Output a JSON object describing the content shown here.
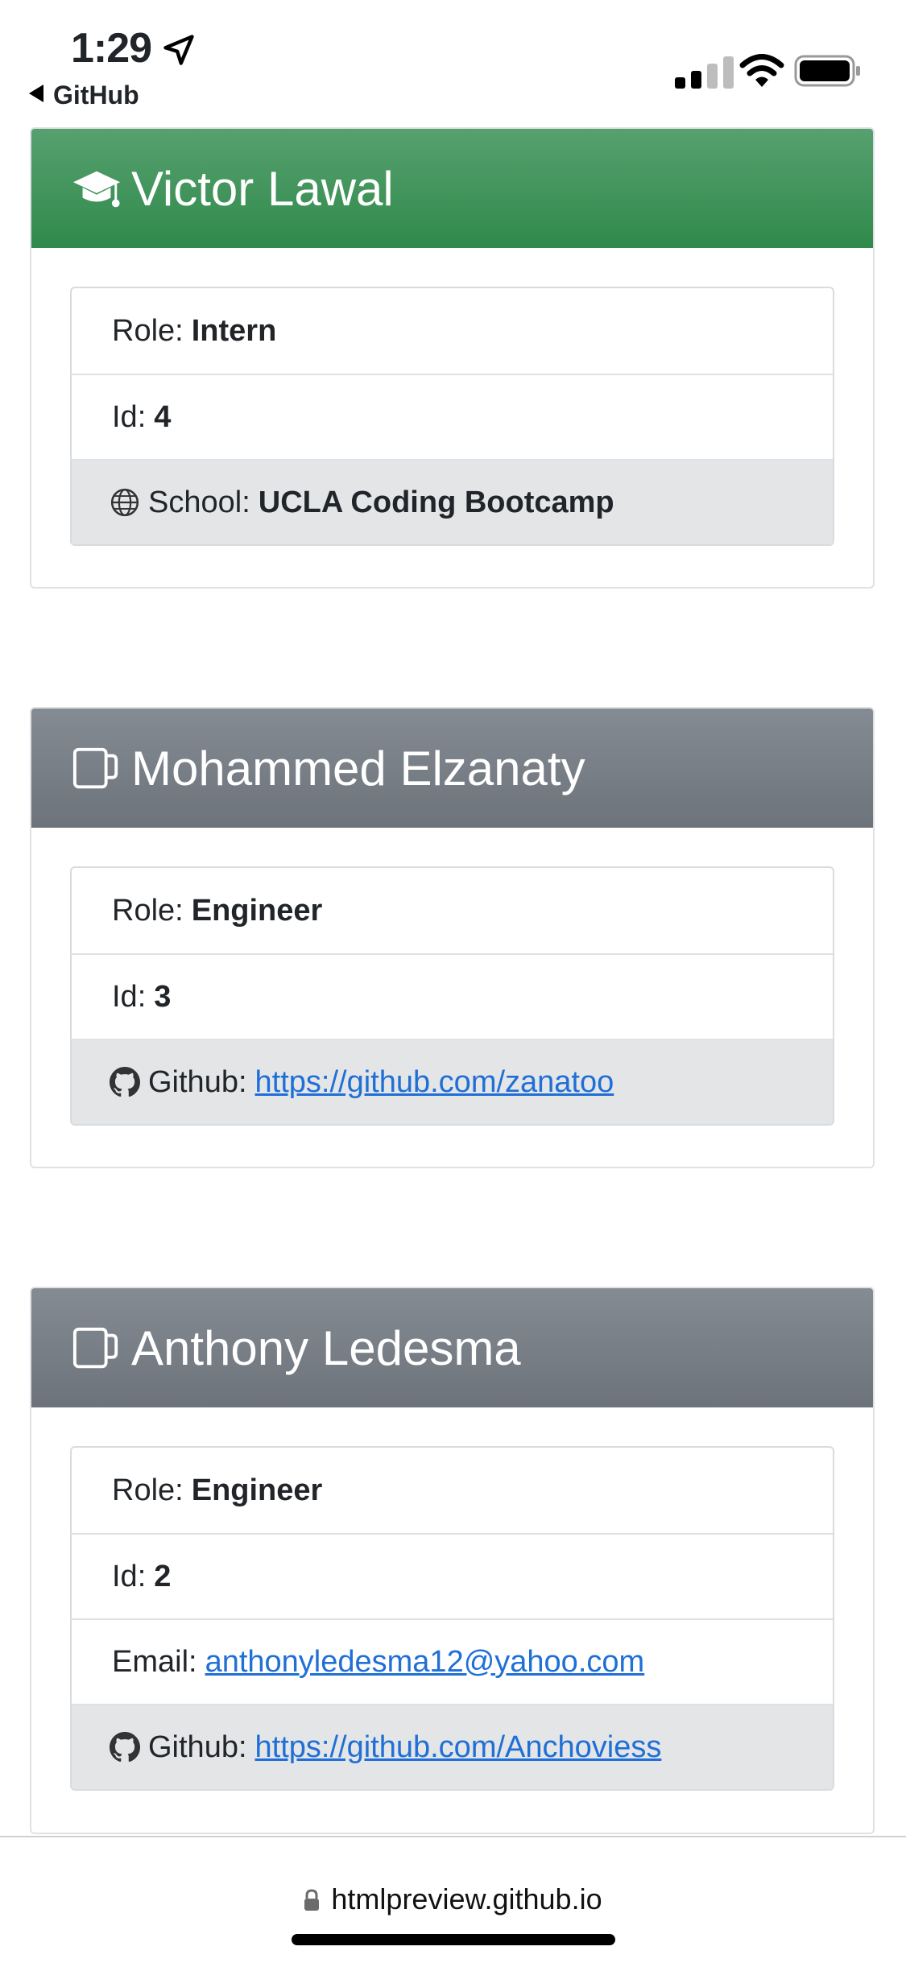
{
  "status_bar": {
    "time": "1:29",
    "back_label": "GitHub"
  },
  "cards": [
    {
      "name": "Victor Lawal",
      "header_color": "#3f9a5e",
      "icon": "graduation-cap-icon",
      "role_label": "Role:",
      "role": "Intern",
      "id_label": "Id:",
      "id": "4",
      "extra": [
        {
          "label": "School:",
          "value": "UCLA Coding Bootcamp",
          "icon": "globe-icon"
        }
      ]
    },
    {
      "name": "Mohammed Elzanaty",
      "header_color": "#737a83",
      "icon": "mug-icon",
      "role_label": "Role:",
      "role": "Engineer",
      "id_label": "Id:",
      "id": "3",
      "extra": [
        {
          "label": "Github:",
          "value": "https://github.com/zanatoo",
          "icon": "github-icon"
        }
      ]
    },
    {
      "name": "Anthony Ledesma",
      "header_color": "#737a83",
      "icon": "mug-icon",
      "role_label": "Role:",
      "role": "Engineer",
      "id_label": "Id:",
      "id": "2",
      "extra": [
        {
          "label": "Email:",
          "value": "anthonyledesma12@yahoo.com"
        },
        {
          "label": "Github:",
          "value": "https://github.com/Anchoviess",
          "icon": "github-icon"
        }
      ]
    }
  ],
  "bottom_bar": {
    "url": "htmlpreview.github.io"
  },
  "colors": {
    "intern_header": "#3f9a5e",
    "engineer_header": "#737a83",
    "link": "#1f6fd6",
    "shaded_row": "#e3e5e7"
  }
}
